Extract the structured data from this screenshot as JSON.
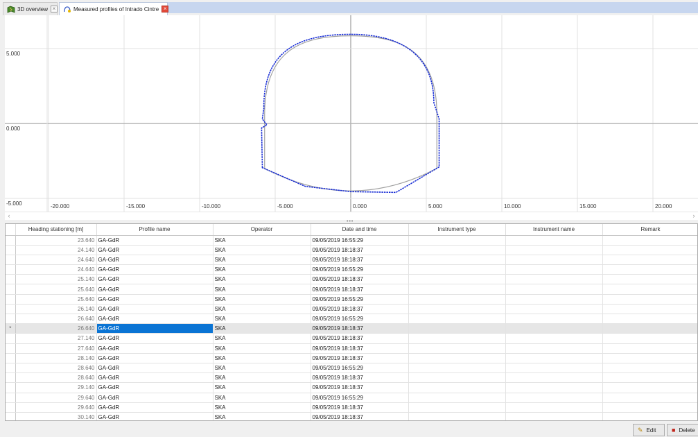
{
  "tabs": [
    {
      "label": "3D overview",
      "active": false,
      "icon": "map-icon"
    },
    {
      "label": "Measured profiles of Intrado Cintre",
      "active": true,
      "icon": "profile-icon"
    }
  ],
  "plot": {
    "y_ticks": [
      "5.000",
      "0.000",
      "-5.000"
    ],
    "x_ticks": [
      "-20.000",
      "-15.000",
      "-10.000",
      "-5.000",
      "0.000",
      "5.000",
      "10.000",
      "15.000",
      "20.000"
    ],
    "design_color": "#a0a0a0",
    "measured_color": "#1a2fd6",
    "grid_color": "#e0e0e0",
    "axis_color": "#b5b5b5"
  },
  "table": {
    "columns": [
      "Heading stationing [m]",
      "Profile name",
      "Operator",
      "Date and time",
      "Instrument type",
      "Instrument name",
      "Remark"
    ],
    "selected_marker": "*",
    "rows": [
      [
        "23.640",
        "GA-GdR",
        "SKA",
        "09/05/2019 16:55:29",
        "",
        "",
        ""
      ],
      [
        "24.140",
        "GA-GdR",
        "SKA",
        "09/05/2019 18:18:37",
        "",
        "",
        ""
      ],
      [
        "24.640",
        "GA-GdR",
        "SKA",
        "09/05/2019 18:18:37",
        "",
        "",
        ""
      ],
      [
        "24.640",
        "GA-GdR",
        "SKA",
        "09/05/2019 16:55:29",
        "",
        "",
        ""
      ],
      [
        "25.140",
        "GA-GdR",
        "SKA",
        "09/05/2019 18:18:37",
        "",
        "",
        ""
      ],
      [
        "25.640",
        "GA-GdR",
        "SKA",
        "09/05/2019 18:18:37",
        "",
        "",
        ""
      ],
      [
        "25.640",
        "GA-GdR",
        "SKA",
        "09/05/2019 16:55:29",
        "",
        "",
        ""
      ],
      [
        "26.140",
        "GA-GdR",
        "SKA",
        "09/05/2019 18:18:37",
        "",
        "",
        ""
      ],
      [
        "26.640",
        "GA-GdR",
        "SKA",
        "09/05/2019 16:55:29",
        "",
        "",
        ""
      ],
      [
        "26.640",
        "GA-GdR",
        "SKA",
        "09/05/2019 18:18:37",
        "",
        "",
        ""
      ],
      [
        "27.140",
        "GA-GdR",
        "SKA",
        "09/05/2019 18:18:37",
        "",
        "",
        ""
      ],
      [
        "27.640",
        "GA-GdR",
        "SKA",
        "09/05/2019 18:18:37",
        "",
        "",
        ""
      ],
      [
        "28.140",
        "GA-GdR",
        "SKA",
        "09/05/2019 18:18:37",
        "",
        "",
        ""
      ],
      [
        "28.640",
        "GA-GdR",
        "SKA",
        "09/05/2019 16:55:29",
        "",
        "",
        ""
      ],
      [
        "28.640",
        "GA-GdR",
        "SKA",
        "09/05/2019 18:18:37",
        "",
        "",
        ""
      ],
      [
        "29.140",
        "GA-GdR",
        "SKA",
        "09/05/2019 18:18:37",
        "",
        "",
        ""
      ],
      [
        "29.640",
        "GA-GdR",
        "SKA",
        "09/05/2019 16:55:29",
        "",
        "",
        ""
      ],
      [
        "29.640",
        "GA-GdR",
        "SKA",
        "09/05/2019 18:18:37",
        "",
        "",
        ""
      ],
      [
        "30.140",
        "GA-GdR",
        "SKA",
        "09/05/2019 18:18:37",
        "",
        "",
        ""
      ]
    ],
    "selected_row": 9
  },
  "buttons": {
    "edit": "Edit",
    "delete": "Delete"
  }
}
